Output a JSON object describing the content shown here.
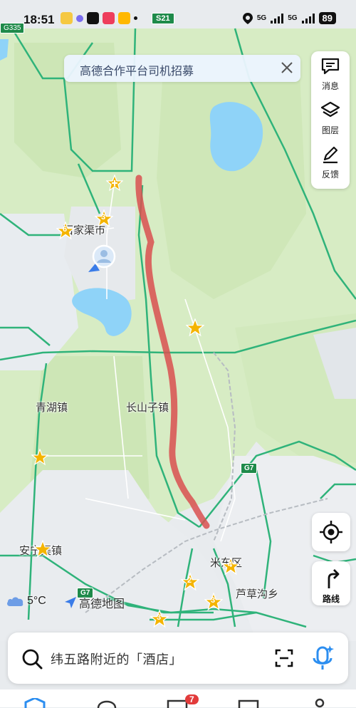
{
  "status_bar": {
    "time": "18:51",
    "road_badge": "S21",
    "signal_1": "5G",
    "signal_2": "5G",
    "battery": "89"
  },
  "map": {
    "road_badges": {
      "g335": "G335",
      "g7_right": "G7",
      "g7_bottom": "G7"
    },
    "place_labels": {
      "town_1": "石家渠市",
      "town_2": "青湖镇",
      "town_3": "长山子镇",
      "town_4": "安宁渠镇",
      "district_1": "米东区",
      "township_1": "芦草沟乡"
    },
    "poi_counts": {
      "p1": "3",
      "p2": "6",
      "p3": "4",
      "p4": "2",
      "p5": "3",
      "p6": "3"
    },
    "colors": {
      "route": "#d95050",
      "water": "#8fd3f8",
      "forest": "#cfe8b8",
      "road": "#2fb37a"
    }
  },
  "banner": {
    "text": "高德合作平台司机招募"
  },
  "right_panel": {
    "messages_label": "消息",
    "layers_label": "图层",
    "feedback_label": "反馈"
  },
  "route_button": {
    "label": "路线"
  },
  "weather": {
    "temperature": "5°C"
  },
  "brand": {
    "name": "高德地图"
  },
  "search": {
    "placeholder": "纬五路附近的「酒店」"
  },
  "bottom_nav": {
    "badge_count": "7"
  }
}
